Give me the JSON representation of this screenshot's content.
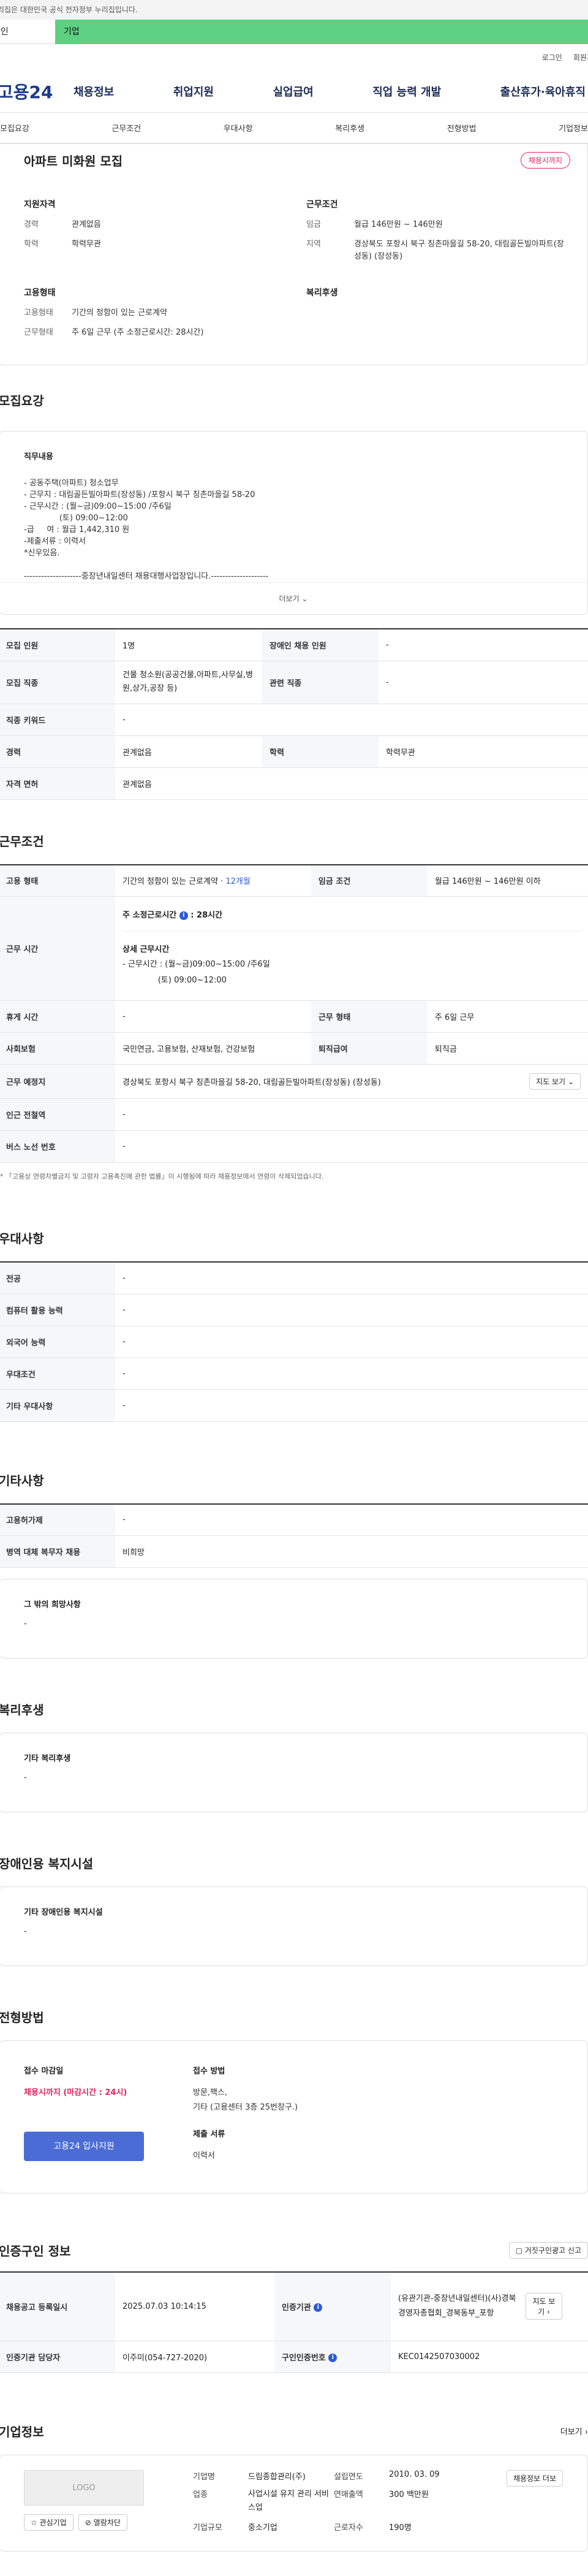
{
  "gov_banner": "이 누리집은 대한민국 공식 전자정부 누리집입니다.",
  "top_tabs": {
    "personal": "개인",
    "company": "기업"
  },
  "util": {
    "login": "로그인",
    "join": "회원가입"
  },
  "logo": "고용24",
  "gnb": [
    "채용정보",
    "취업지원",
    "실업급여",
    "직업 능력 개발",
    "출산휴가·육아휴직"
  ],
  "subtabs": [
    "모집요강",
    "근무조건",
    "우대사항",
    "복리후생",
    "전형방법",
    "기업정보"
  ],
  "summary": {
    "title": "아파트 미화원 모집",
    "badge": "채용시까지",
    "qual_title": "지원자격",
    "cond_title": "근무조건",
    "emp_title": "고용형태",
    "welfare_title": "복리후생",
    "qual": [
      {
        "k": "경력",
        "v": "관계없음"
      },
      {
        "k": "학력",
        "v": "학력무관"
      }
    ],
    "cond": [
      {
        "k": "임금",
        "v": "월급 146만원 ~ 146만원"
      },
      {
        "k": "지역",
        "v": "경상북도 포항시 북구 칭촌마을길 58-20, 대림골든빌아파트(장성동) (장성동)"
      }
    ],
    "emp": [
      {
        "k": "고용형태",
        "v": "기간의 정함이 있는 근로계약"
      },
      {
        "k": "근무형태",
        "v": "주 6일 근무 (주 소정근로시간: 28시간)"
      }
    ]
  },
  "recruit": {
    "section_title": "모집요강",
    "duty_label": "직무내용",
    "duty_text": "- 공동주택(아파트) 청소업무\n- 근무지 : 대림골든빌아파트(장성동) /포항시 북구 칭촌마을길 58-20\n- 근무시간 : (월~금)09:00~15:00 /주6일\n              (토) 09:00~12:00\n-급     여 : 월급 1,442,310 원\n-제출서류 : 이력서\n*신우있음.\n\n--------------------중장년내일센터 채용대행사업장입니다.--------------------",
    "more": "더보기",
    "rows": {
      "headcount_k": "모집 인원",
      "headcount_v": "1명",
      "disabled_k": "장애인 채용 인원",
      "disabled_v": "-",
      "job_k": "모집 직종",
      "job_v": "건물 청소원(공공건물,아파트,사무실,병원,상가,공장 등)",
      "related_k": "관련 직종",
      "related_v": "-",
      "keyword_k": "직종 키워드",
      "keyword_v": "-",
      "career_k": "경력",
      "career_v": "관계없음",
      "edu_k": "학력",
      "edu_v": "학력무관",
      "license_k": "자격 면허",
      "license_v": "관계없음"
    }
  },
  "work": {
    "section_title": "근무조건",
    "emp_k": "고용 형태",
    "emp_v": "기간의 정함이 있는 근로계약 · ",
    "emp_months": "12개월",
    "wage_k": "임금 조건",
    "wage_v": "월급 146만원 ~ 146만원 이하",
    "hours_k": "근무 시간",
    "hours_week_label": "주 소정근로시간",
    "hours_week_v": "28시간",
    "hours_detail_label": "상세 근무시간",
    "hours_detail": "- 근무시간 : (월~금)09:00~15:00 /주6일\n              (토) 09:00~12:00",
    "holiday_k": "휴게 시간",
    "holiday_v": "-",
    "form_k": "근무 형태",
    "form_v": "주 6일 근무",
    "insurance_k": "사회보험",
    "insurance_v": "국민연금, 고용보험, 산재보험, 건강보험",
    "retire_k": "퇴직급여",
    "retire_v": "퇴직금",
    "place_k": "근무 예정지",
    "place_v": "경상북도 포항시 북구 칭촌마을길 58-20, 대림골든빌아파트(장성동) (장성동)",
    "map_btn": "지도 보기",
    "station_k": "인근 전철역",
    "station_v": "-",
    "bus_k": "버스 노선 번호",
    "bus_v": "-",
    "note": "* 「고용상 연령차별금지 및 고령자 고용촉진에 관한 법률」이 시행됨에 따라 채용정보에서 연령이 삭제되었습니다."
  },
  "prefer": {
    "section_title": "우대사항",
    "rows": [
      {
        "k": "전공",
        "v": "-"
      },
      {
        "k": "컴퓨터 활용 능력",
        "v": "-"
      },
      {
        "k": "외국어 능력",
        "v": "-"
      },
      {
        "k": "우대조건",
        "v": "-"
      },
      {
        "k": "기타 우대사항",
        "v": "-"
      }
    ]
  },
  "etc": {
    "section_title": "기타사항",
    "rows": [
      {
        "k": "고용허가제",
        "v": "-"
      },
      {
        "k": "병역 대체 복무자 채용",
        "v": "비희망"
      }
    ],
    "other_label": "그 밖의 희망사항",
    "other_v": "-"
  },
  "welfare": {
    "section_title": "복리후생",
    "label": "기타 복리후생",
    "v": "-"
  },
  "disabled": {
    "section_title": "장애인용 복지시설",
    "label": "기타 장애인용 복지시설",
    "v": "-"
  },
  "selection": {
    "section_title": "전형방법",
    "deadline_label": "접수 마감일",
    "deadline_v": "채용시까지 (마감시간 : 24시)",
    "apply_btn": "고용24 입사지원",
    "method_label": "접수 방법",
    "method_v": "방문,팩스,\n기타 (고용센터 3층 25번창구.)",
    "docs_label": "제출 서류",
    "docs_v": "이력서"
  },
  "cert": {
    "section_title": "인증구인 정보",
    "report_btn": "거짓구인광고 신고",
    "reg_k": "채용공고 등록일시",
    "reg_v": "2025.07.03 10:14:15",
    "org_k": "인증기관",
    "org_v": "(유관기관-중장년내일센터)(사)경북경영자총협회_경북동부_포항",
    "map_btn": "지도 보기",
    "manager_k": "인증기관 담당자",
    "manager_v": "이주미(054-727-2020)",
    "num_k": "구인인증번호",
    "num_v": "KEC0142507030002"
  },
  "company": {
    "section_title": "기업정보",
    "more": "더보기",
    "logo": "LOGO",
    "fav_btn": "관심기업",
    "view_btn": "열람차단",
    "list_btn": "채용정보 더보",
    "name_k": "기업명",
    "name_v": "드림종합관리(주)",
    "year_k": "설립연도",
    "year_v": "2010. 03. 09",
    "industry_k": "업종",
    "industry_v": "사업시설 유지 관리 서비스업",
    "sales_k": "연매출액",
    "sales_v": "300 백만원",
    "size_k": "기업규모",
    "size_v": "중소기업",
    "staff_k": "근로자수",
    "staff_v": "190명"
  },
  "colors": {
    "accent_green": "#5ed081",
    "brand_blue": "#1d3a8a",
    "deadline_red": "#e0245e",
    "button_blue": "#4a6cd4"
  }
}
